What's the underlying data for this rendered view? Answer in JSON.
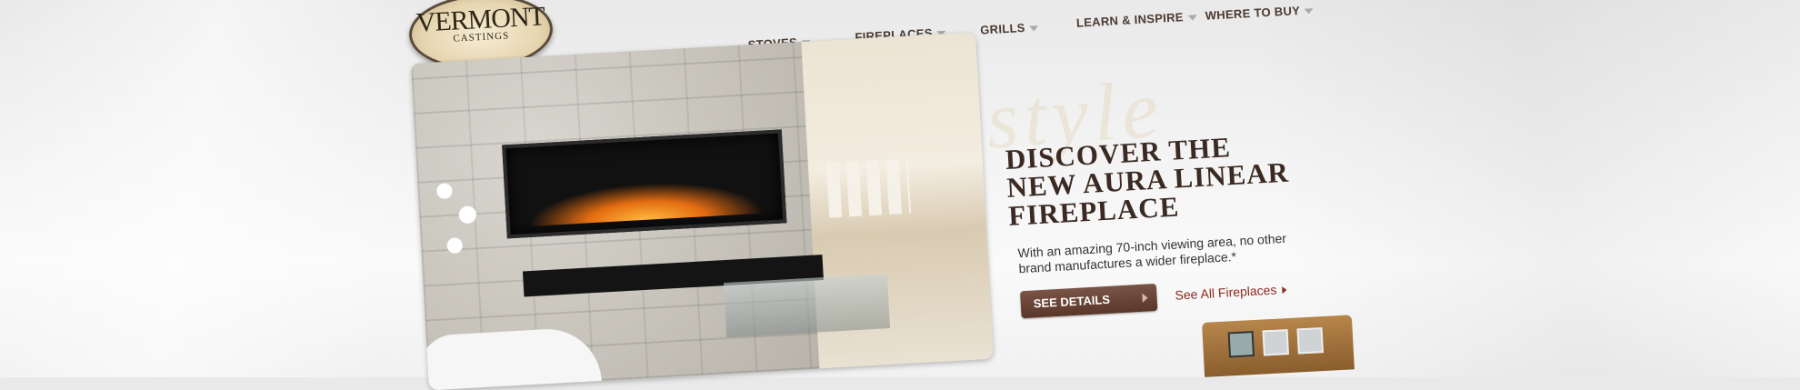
{
  "brand": {
    "line1": "VERMONT",
    "line2": "CASTINGS"
  },
  "nav": {
    "items": [
      {
        "label": "STOVES"
      },
      {
        "label": "FIREPLACES"
      },
      {
        "label": "GRILLS"
      },
      {
        "label": "LEARN & INSPIRE"
      },
      {
        "label": "WHERE TO BUY"
      }
    ]
  },
  "hero": {
    "script_word": "style",
    "headline_lines": [
      "DISCOVER THE",
      "NEW AURA LINEAR",
      "FIREPLACE"
    ],
    "blurb": "With an amazing 70-inch viewing area, no other brand manufactures a wider fireplace.*",
    "cta_label": "SEE DETAILS",
    "link_label": "See All Fireplaces"
  },
  "carousel": {
    "slides": 3,
    "active": 1
  },
  "colors": {
    "accent": "#5a3729",
    "link": "#8c2b1e",
    "nav_text": "#4a3a30"
  }
}
